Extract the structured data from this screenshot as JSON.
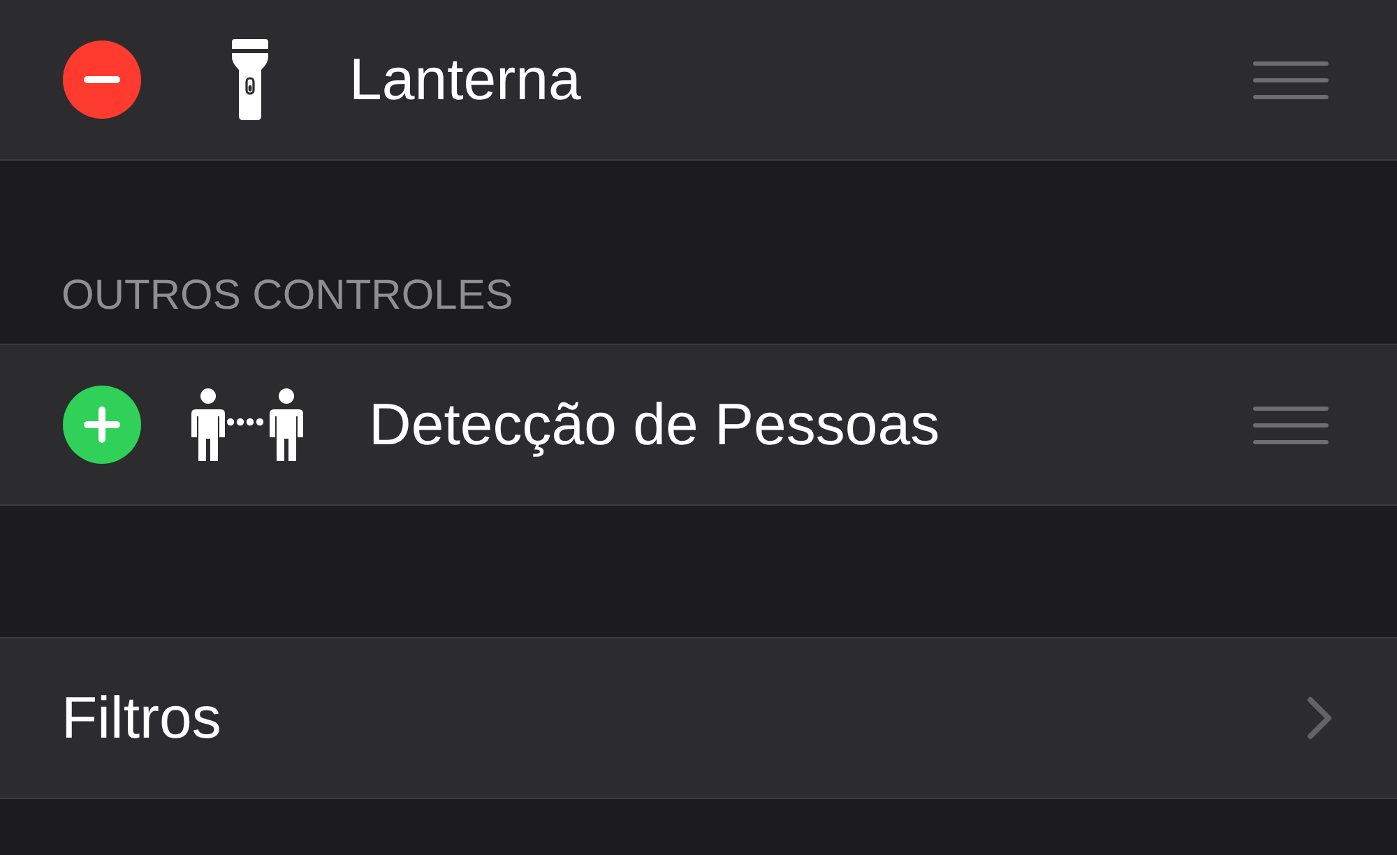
{
  "included_controls": {
    "items": [
      {
        "label": "Lanterna",
        "kind": "remove"
      }
    ]
  },
  "other_controls": {
    "header": "OUTROS CONTROLES",
    "items": [
      {
        "label": "Detecção de Pessoas",
        "kind": "add"
      }
    ]
  },
  "links": [
    {
      "label": "Filtros"
    }
  ]
}
